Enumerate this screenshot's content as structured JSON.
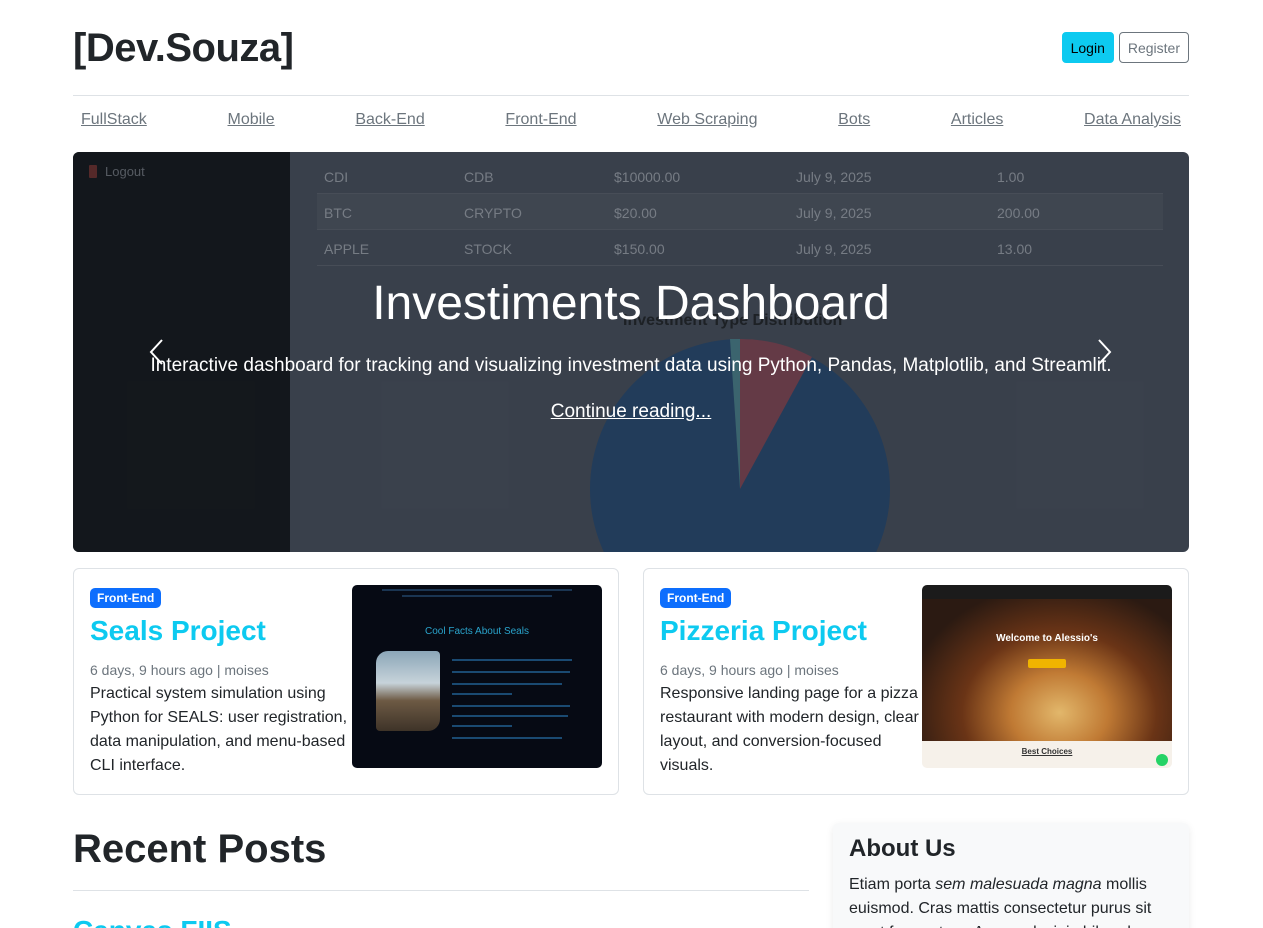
{
  "header": {
    "brand": "[Dev.Souza]",
    "login_label": "Login",
    "register_label": "Register"
  },
  "nav": {
    "items": [
      "FullStack",
      "Mobile",
      "Back-End",
      "Front-End",
      "Web Scraping",
      "Bots",
      "Articles",
      "Data Analysis"
    ]
  },
  "carousel": {
    "title": "Investiments Dashboard",
    "text": "Interactive dashboard for tracking and visualizing investment data using Python, Pandas, Matplotlib, and Streamlit.",
    "link": "Continue reading...",
    "screenshot": {
      "logout": "Logout",
      "rows": [
        [
          "CDI",
          "CDB",
          "$10000.00",
          "July 9, 2025",
          "1.00"
        ],
        [
          "BTC",
          "CRYPTO",
          "$20.00",
          "July 9, 2025",
          "200.00"
        ],
        [
          "APPLE",
          "STOCK",
          "$150.00",
          "July 9, 2025",
          "13.00"
        ]
      ],
      "chart_title": "Investment Type Distribution"
    }
  },
  "featured": [
    {
      "badge": "Front-End",
      "title": "Seals Project",
      "meta": "6 days, 9 hours ago | moises",
      "desc": "Practical system simulation using Python for SEALS: user registration, data manipulation, and menu-based CLI interface.",
      "thumb_title": "Cool Facts About Seals"
    },
    {
      "badge": "Front-End",
      "title": "Pizzeria Project",
      "meta": "6 days, 9 hours ago | moises",
      "desc": "Responsive landing page for a pizza restaurant with modern design, clear layout, and conversion-focused visuals.",
      "thumb_title": "Welcome to Alessio's",
      "thumb_section": "Best Choices"
    }
  ],
  "recent": {
    "heading": "Recent Posts",
    "first_title": "Canvas FIIS"
  },
  "about": {
    "heading": "About Us",
    "text_a": "Etiam porta ",
    "text_em": "sem malesuada magna",
    "text_b": " mollis euismod. Cras mattis consectetur purus sit amet fermentum. Aenean lacinia bibendum nulla sed consectetur."
  },
  "colors": {
    "accent": "#0dcaf0",
    "badge": "#0d6efd",
    "muted": "#6c757d"
  }
}
